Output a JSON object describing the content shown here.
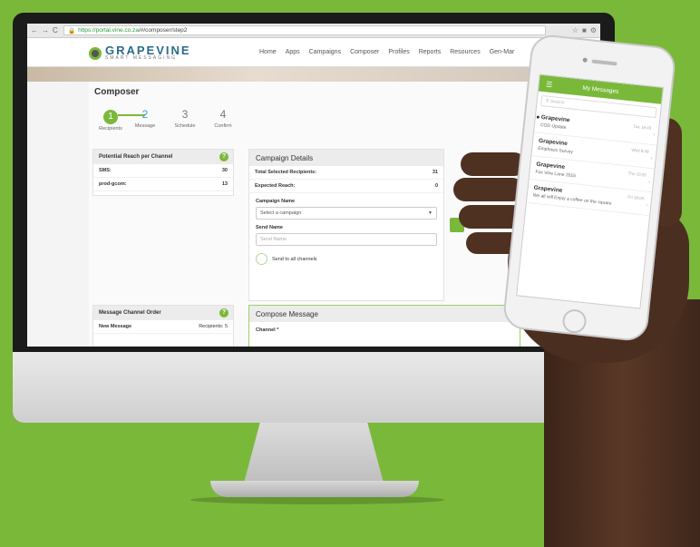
{
  "browser": {
    "url_host": "https://portal.vine.co.za",
    "url_path": "/#/composer/step2"
  },
  "brand": {
    "name": "GRAPEVINE",
    "tagline": "SMART MESSAGING"
  },
  "nav": [
    "Home",
    "Apps",
    "Campaigns",
    "Composer",
    "Profiles",
    "Reports",
    "Resources",
    "Gen-Mar"
  ],
  "composer": {
    "title": "Composer",
    "steps": [
      {
        "num": "1",
        "label": "Recipients"
      },
      {
        "num": "2",
        "label": "Message"
      },
      {
        "num": "3",
        "label": "Schedule"
      },
      {
        "num": "4",
        "label": "Confirm"
      }
    ]
  },
  "reach": {
    "title": "Potential Reach per Channel",
    "badge": "?",
    "rows": [
      {
        "label": "SMS:",
        "value": "30"
      },
      {
        "label": "prod-gcom:",
        "value": "13"
      }
    ]
  },
  "campaign": {
    "title": "Campaign Details",
    "total_label": "Total Selected Recipients:",
    "total_value": "31",
    "expected_label": "Expected Reach:",
    "expected_value": "0",
    "name_label": "Campaign Name",
    "name_select": "Select a campaign",
    "send_label": "Send Name",
    "send_placeholder": "Send Name",
    "toggle_label": "Send to all channels"
  },
  "channel_order": {
    "title": "Message Channel Order",
    "badge": "?",
    "item": "New Message",
    "recipients": "Recipients: 5"
  },
  "compose": {
    "title": "Compose Message",
    "channel_label": "Channel *"
  },
  "phone": {
    "title": "My Messages",
    "search": "Search",
    "messages": [
      {
        "from": "Grapevine",
        "body": "COD Update",
        "time": "Tue 16:43"
      },
      {
        "from": "Grapevine",
        "body": "Emphasis Survey",
        "time": "Wed 8:49"
      },
      {
        "from": "Grapevine",
        "body": "Fox Vine Lane 2015",
        "time": "Thu 10:26"
      },
      {
        "from": "Grapevine",
        "body": "We all will Enjoy a coffee on the square",
        "time": "Fri 18:05"
      }
    ]
  },
  "colors": {
    "accent": "#7ab83a",
    "link": "#3f9ad6",
    "background": "#7ab83a"
  }
}
